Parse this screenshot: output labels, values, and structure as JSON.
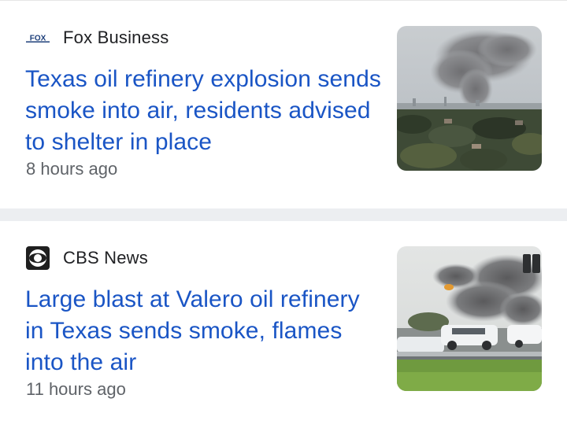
{
  "articles": [
    {
      "source": "Fox Business",
      "source_logo_text": "FOX",
      "headline": "Texas oil refinery explosion sends smoke into air, residents advised to shelter in place",
      "time": "8 hours ago",
      "thumbnail_icon": "refinery-smoke-skyline-photo"
    },
    {
      "source": "CBS News",
      "headline": "Large blast at Valero oil refinery in Texas sends smoke, flames into the air",
      "time": "11 hours ago",
      "thumbnail_icon": "highway-smoke-photo"
    }
  ],
  "colors": {
    "headline": "#1a55c5",
    "source": "#202124",
    "time": "#5f6368",
    "separator": "#eceef1"
  }
}
